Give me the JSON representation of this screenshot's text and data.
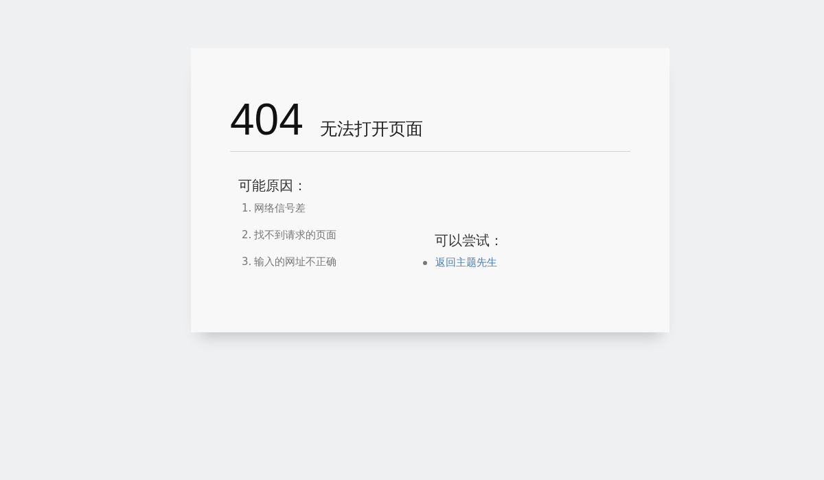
{
  "error": {
    "code": "404",
    "title": "无法打开页面"
  },
  "reasons": {
    "heading": "可能原因：",
    "items": [
      {
        "number": "1.",
        "text": "网络信号差"
      },
      {
        "number": "2.",
        "text": "找不到请求的页面"
      },
      {
        "number": "3.",
        "text": "输入的网址不正确"
      }
    ]
  },
  "suggestions": {
    "heading": "可以尝试：",
    "links": [
      {
        "text": "返回主题先生"
      }
    ]
  }
}
